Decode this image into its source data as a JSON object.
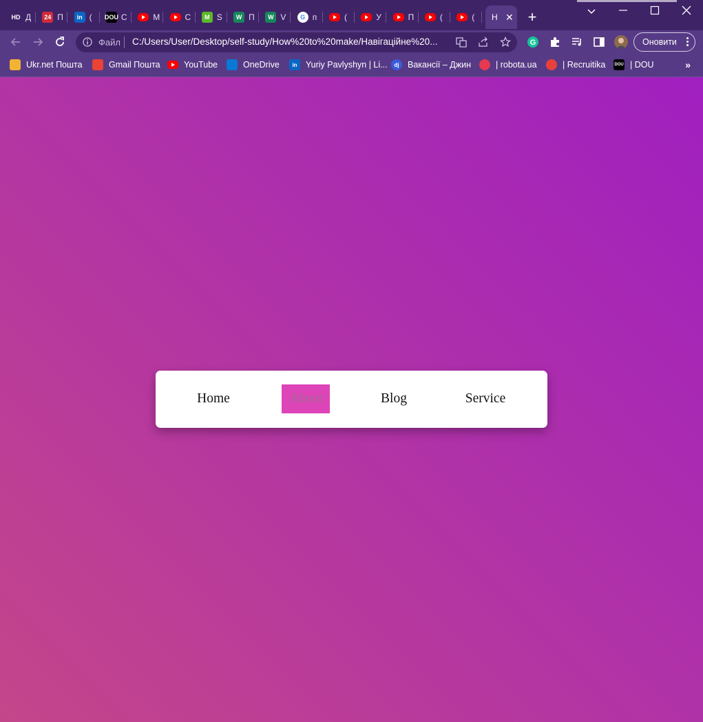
{
  "browser": {
    "tabs": [
      {
        "favicon": "hd-icon",
        "fav_text": "HD",
        "fav_color": "#3f2367",
        "title": "Д"
      },
      {
        "favicon": "24-icon",
        "fav_text": "24",
        "fav_color": "#d12b3a",
        "title": "П"
      },
      {
        "favicon": "linkedin-icon",
        "fav_text": "in",
        "fav_color": "#0a66c2",
        "title": "("
      },
      {
        "favicon": "dou-icon",
        "fav_text": "DOU",
        "fav_color": "#000000",
        "title": "С"
      },
      {
        "favicon": "youtube-icon",
        "fav_text": "",
        "fav_color": "#ff0000",
        "title": "М"
      },
      {
        "favicon": "youtube-icon",
        "fav_text": "",
        "fav_color": "#ff0000",
        "title": "С"
      },
      {
        "favicon": "m-icon",
        "fav_text": "M",
        "fav_color": "#5cb82a",
        "title": "S"
      },
      {
        "favicon": "w-icon",
        "fav_text": "W",
        "fav_color": "#16875a",
        "title": "П"
      },
      {
        "favicon": "w-icon",
        "fav_text": "W",
        "fav_color": "#16875a",
        "title": "V"
      },
      {
        "favicon": "google-icon",
        "fav_text": "G",
        "fav_color": "#ffffff",
        "title": "п"
      },
      {
        "favicon": "youtube-icon",
        "fav_text": "",
        "fav_color": "#ff0000",
        "title": "("
      },
      {
        "favicon": "youtube-icon",
        "fav_text": "",
        "fav_color": "#ff0000",
        "title": "У"
      },
      {
        "favicon": "youtube-icon",
        "fav_text": "",
        "fav_color": "#ff0000",
        "title": "П"
      },
      {
        "favicon": "youtube-icon",
        "fav_text": "",
        "fav_color": "#ff0000",
        "title": "("
      },
      {
        "favicon": "youtube-icon",
        "fav_text": "",
        "fav_color": "#ff0000",
        "title": "("
      }
    ],
    "active_tab": {
      "title": "Н",
      "close": "✕"
    },
    "new_tab_label": "+",
    "address": {
      "scheme_label": "Файл",
      "url": "C:/Users/User/Desktop/self-study/How%20to%20make/Навігаційне%20..."
    },
    "update_button": "Оновити",
    "bookmarks": [
      {
        "label": "Ukr.net Пошта",
        "icon": "ukrnet-icon",
        "color": "#f2b233"
      },
      {
        "label": "Gmail Пошта",
        "icon": "gmail-icon",
        "color": "#ea4335"
      },
      {
        "label": "YouTube",
        "icon": "youtube-icon",
        "color": "#ff0000"
      },
      {
        "label": "OneDrive",
        "icon": "onedrive-icon",
        "color": "#0a78d4"
      },
      {
        "label": "Yuriy Pavlyshyn | Li...",
        "icon": "linkedin-icon",
        "color": "#0a66c2"
      },
      {
        "label": "Вакансії – Джин",
        "icon": "djinni-icon",
        "color": "#3b5bdb"
      },
      {
        "label": "| robota.ua",
        "icon": "robota-icon",
        "color": "#e53950"
      },
      {
        "label": "| Recruitika",
        "icon": "recruitika-icon",
        "color": "#e8413c"
      },
      {
        "label": "| DOU",
        "icon": "dou-icon",
        "color": "#000000"
      }
    ],
    "bookmarks_more": "»"
  },
  "page": {
    "nav": {
      "items": [
        {
          "label": "Home",
          "active": false
        },
        {
          "label": "About",
          "active": true
        },
        {
          "label": "Blog",
          "active": false
        },
        {
          "label": "Service",
          "active": false
        }
      ]
    },
    "colors": {
      "gradient_start": "#c4468a",
      "gradient_end": "#a01fc0",
      "active_highlight": "#dd44b8"
    }
  }
}
